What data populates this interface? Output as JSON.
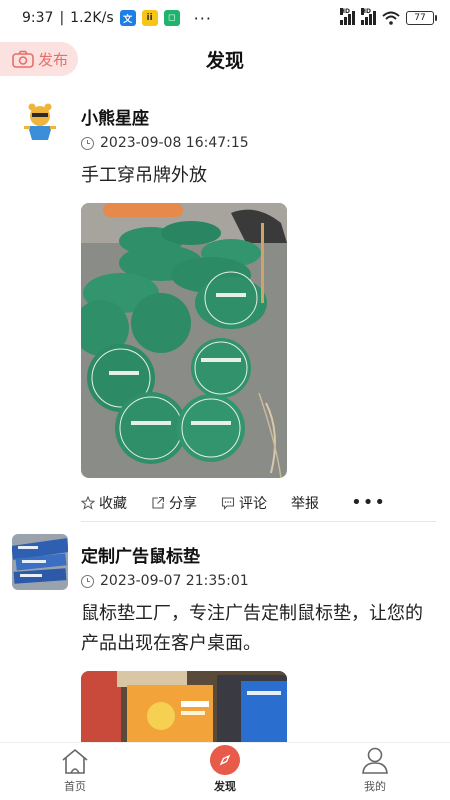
{
  "status_bar": {
    "time": "9:37",
    "speed": "1.2K/s",
    "more": "···",
    "signal_labels": [
      "HD",
      "HD"
    ],
    "battery": "77"
  },
  "header": {
    "publish_label": "发布",
    "title": "发现"
  },
  "posts": [
    {
      "author": "小熊星座",
      "time": "2023-09-08 16:47:15",
      "content": "手工穿吊牌外放",
      "actions": {
        "favorite": "收藏",
        "share": "分享",
        "comment": "评论",
        "report": "举报",
        "more": "•••"
      }
    },
    {
      "author": "定制广告鼠标垫",
      "time": "2023-09-07 21:35:01",
      "content": "鼠标垫工厂，专注广告定制鼠标垫，让您的产品出现在客户桌面。"
    }
  ],
  "bottom_nav": {
    "home": "首页",
    "discover": "发现",
    "me": "我的"
  },
  "colors": {
    "accent": "#e85a4a",
    "publish_bg": "#fbe1df",
    "tag_green": "#2f8f68"
  }
}
